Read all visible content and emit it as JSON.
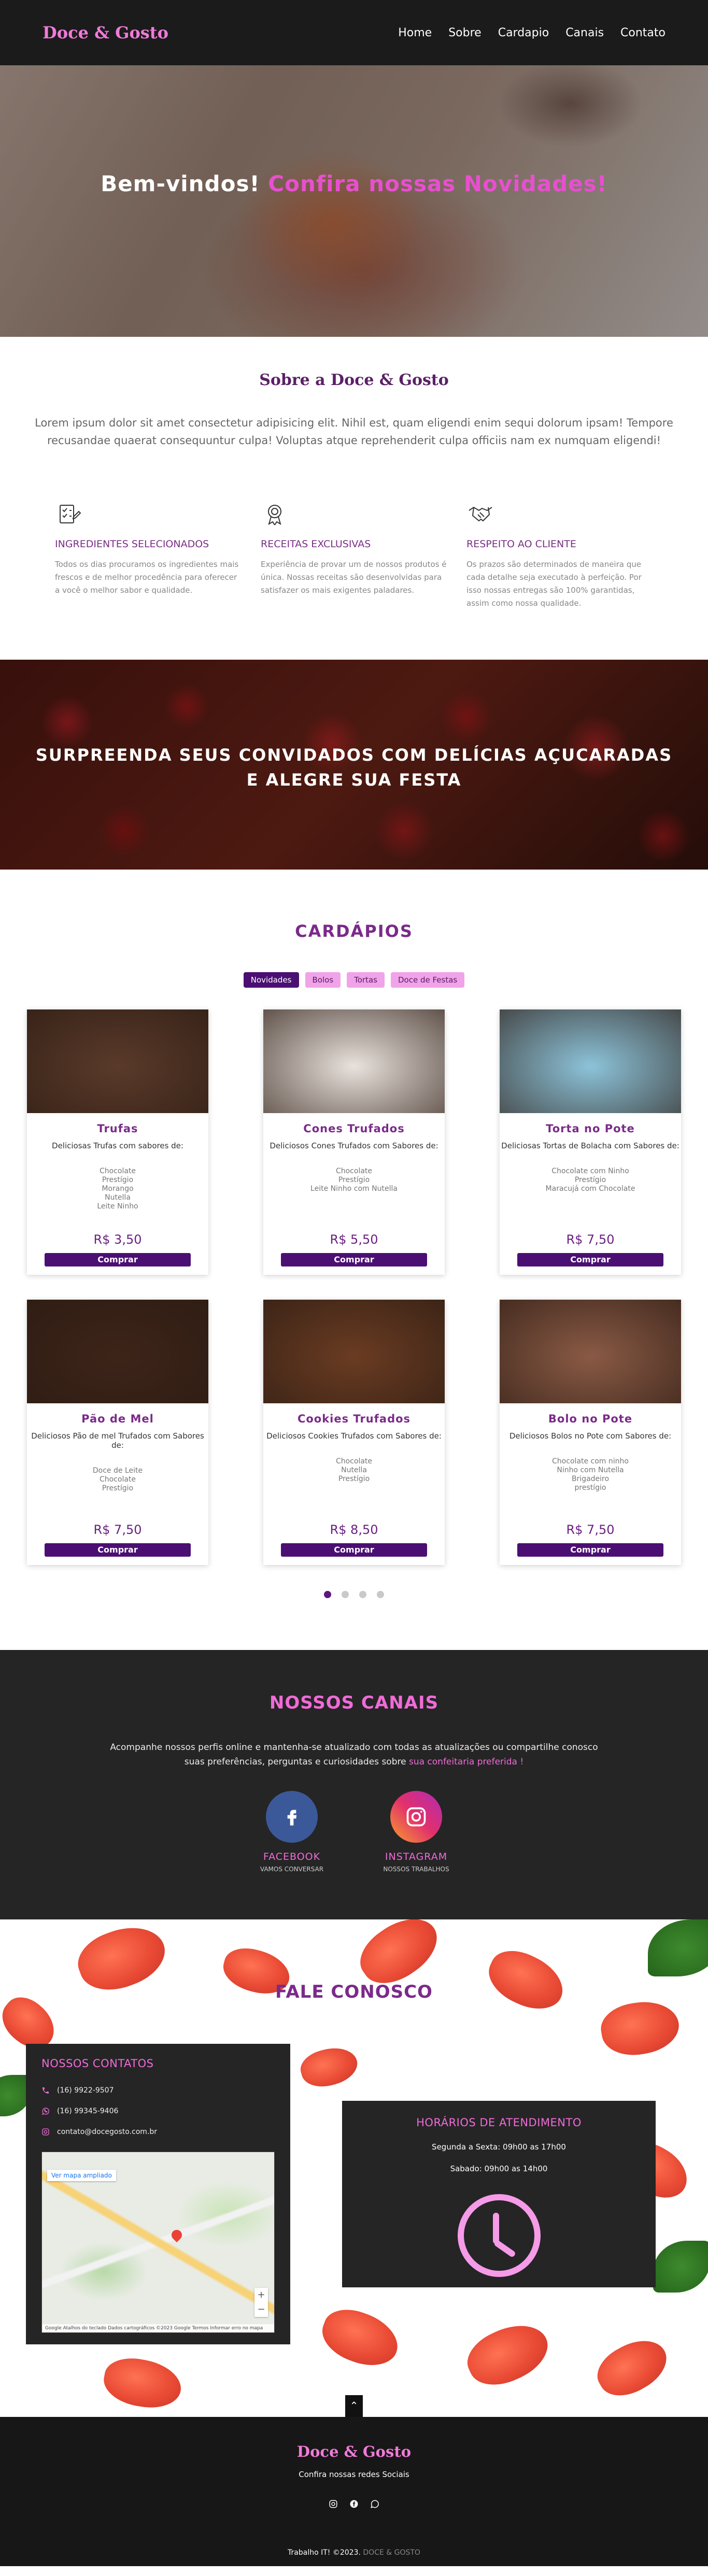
{
  "nav": {
    "brand": "Doce & Gosto",
    "links": [
      "Home",
      "Sobre",
      "Cardapio",
      "Canais",
      "Contato"
    ]
  },
  "hero": {
    "title_white": "Bem-vindos!",
    "title_pink": "Confira nossas Novidades!"
  },
  "about": {
    "title": "Sobre a Doce & Gosto",
    "lead": "Lorem ipsum dolor sit amet consectetur adipisicing elit. Nihil est, quam eligendi enim sequi dolorum ipsam! Tempore recusandae quaerat consequuntur culpa! Voluptas atque reprehenderit culpa officiis nam ex numquam eligendi!",
    "features": [
      {
        "icon": "checklist-icon",
        "title": "INGREDIENTES SELECIONADOS",
        "text": "Todos os dias procuramos os ingredientes mais frescos e de melhor procedência para oferecer a você o melhor sabor e qualidade."
      },
      {
        "icon": "medal-icon",
        "title": "RECEITAS EXCLUSIVAS",
        "text": "Experiência de provar um de nossos produtos é única. Nossas receitas são desenvolvidas para satisfazer os mais exigentes paladares."
      },
      {
        "icon": "handshake-icon",
        "title": "RESPEITO AO CLIENTE",
        "text": "Os prazos são determinados de maneira que cada detalhe seja executado à perfeição. Por isso nossas entregas são 100% garantidas, assim como nossa qualidade."
      }
    ]
  },
  "banner": {
    "line1": "SURPREENDA SEUS CONVIDADOS COM DELÍCIAS AÇUCARADAS",
    "line2": "E ALEGRE SUA FESTA"
  },
  "menu": {
    "title": "CARDÁPIOS",
    "filters": [
      "Novidades",
      "Bolos",
      "Tortas",
      "Doce de Festas"
    ],
    "active_filter": "Novidades",
    "buy_label": "Comprar",
    "items": [
      {
        "name": "Trufas",
        "desc": "Deliciosas Trufas com sabores de:",
        "flavors": [
          "Chocolate",
          "Prestígio",
          "Morango",
          "Nutella",
          "Leite Ninho"
        ],
        "price": "R$ 3,50",
        "color": "#5a3a2a"
      },
      {
        "name": "Cones Trufados",
        "desc": "Deliciosos Cones Trufados com Sabores de:",
        "flavors": [
          "Chocolate",
          "Prestígio",
          "Leite Ninho com Nutella"
        ],
        "price": "R$ 5,50",
        "color": "#e9e2dc"
      },
      {
        "name": "Torta no Pote",
        "desc": "Deliciosas Tortas de Bolacha com Sabores de:",
        "flavors": [
          "Chocolate com Ninho",
          "Prestígio",
          "Maracujá com Chocolate"
        ],
        "price": "R$ 7,50",
        "color": "#8cc3d9"
      },
      {
        "name": "Pão de Mel",
        "desc": "Deliciosos Pão de mel Trufados com Sabores de:",
        "flavors": [
          "Doce de Leite",
          "Chocolate",
          "Prestígio"
        ],
        "price": "R$ 7,50",
        "color": "#3d2419"
      },
      {
        "name": "Cookies Trufados",
        "desc": "Deliciosos Cookies Trufados com Sabores de:",
        "flavors": [
          "Chocolate",
          "Nutella",
          "Prestígio"
        ],
        "price": "R$ 8,50",
        "color": "#6a3c22"
      },
      {
        "name": "Bolo no Pote",
        "desc": "Deliciosos Bolos no Pote com Sabores de:",
        "flavors": [
          "Chocolate com ninho",
          "Ninho com Nutella",
          "Brigadeiro",
          "prestígio"
        ],
        "price": "R$ 7,50",
        "color": "#8a5a45"
      }
    ],
    "pages": 4,
    "active_page": 1
  },
  "channels": {
    "title": "NOSSOS CANAIS",
    "text": "Acompanhe nossos perfis online e mantenha-se atualizado com todas as atualizações ou compartilhe conosco suas preferências, perguntas e curiosidades sobre",
    "text_pink": "sua confeitaria preferida !",
    "facebook": {
      "label": "FACEBOOK",
      "sub": "VAMOS CONVERSAR"
    },
    "instagram": {
      "label": "INSTAGRAM",
      "sub": "NOSSOS TRABALHOS"
    }
  },
  "contact": {
    "title": "FALE CONOSCO",
    "box_title": "NOSSOS CONTATOS",
    "phone": "(16) 9922-9507",
    "whatsapp": "(16) 99345-9406",
    "email": "contato@docegosto.com.br",
    "map_button": "Ver mapa ampliado",
    "map_attrib": "Google  Atalhos do teclado  Dados cartográficos ©2023 Google  Termos  Informar erro no mapa",
    "hours_title": "HORÁRIOS DE ATENDIMENTO",
    "hours_weekday": "Segunda a Sexta: 09h00 as 17h00",
    "hours_saturday": "Sabado: 09h00 as 14h00"
  },
  "footer": {
    "brand": "Doce & Gosto",
    "sub": "Confira nossas redes Sociais",
    "copy": "Trabalho IT! ©2023.",
    "copy_dim": "DOCE & GOSTO"
  }
}
